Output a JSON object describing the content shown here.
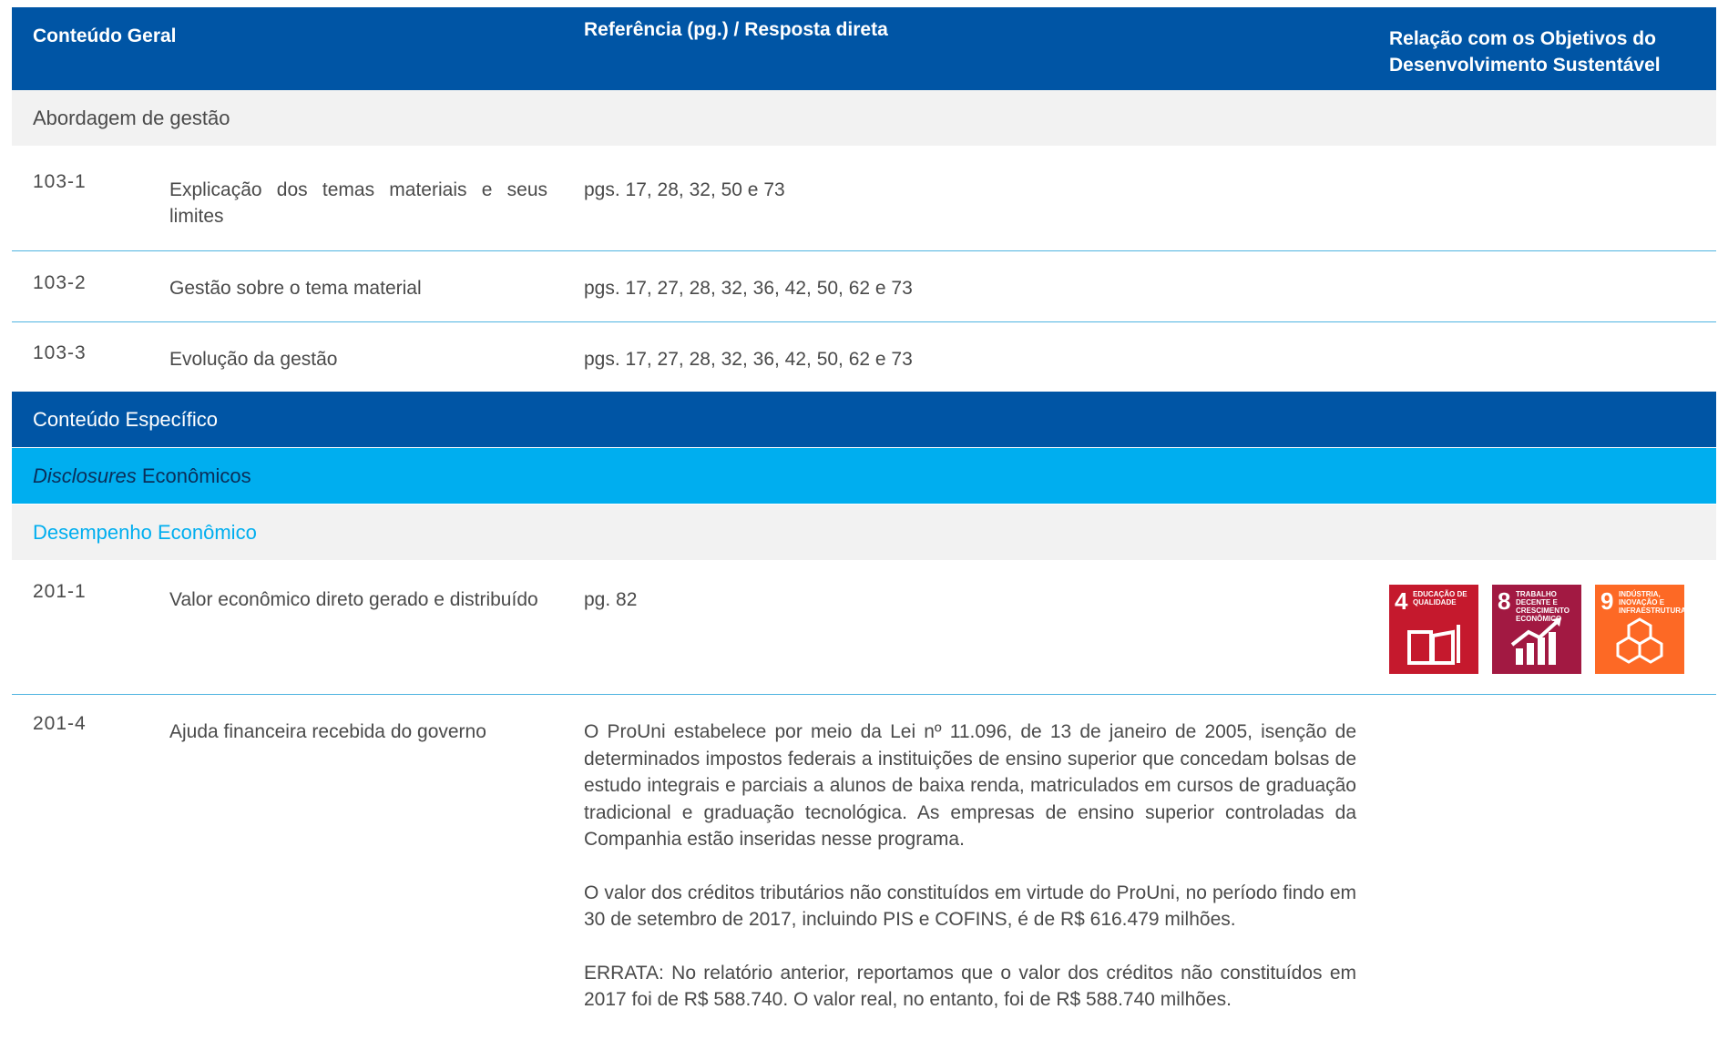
{
  "header": {
    "col1": "Conteúdo Geral",
    "col2": "Referência (pg.) / Resposta direta",
    "col3": "Relação  com os Objetivos do Desenvolvimento Sustentável"
  },
  "sections": {
    "management": "Abordagem de gestão",
    "specific": "Conteúdo Específico",
    "disclosures_italic": "Disclosures",
    "disclosures_rest": " Econômicos",
    "economic_performance": "Desempenho Econômico"
  },
  "rows": [
    {
      "code": "103-1",
      "desc": "Explicação dos temas materiais e seus limites",
      "ref": "pgs. 17, 28, 32, 50 e 73"
    },
    {
      "code": "103-2",
      "desc": "Gestão sobre o tema material",
      "ref": "pgs. 17, 27, 28, 32, 36, 42, 50, 62 e 73"
    },
    {
      "code": "103-3",
      "desc": "Evolução da gestão",
      "ref": "pgs. 17, 27, 28, 32, 36, 42, 50, 62 e 73"
    },
    {
      "code": "201-1",
      "desc": "Valor econômico direto gerado e distribuído",
      "ref": "pg. 82"
    },
    {
      "code": "201-4",
      "desc": "Ajuda financeira recebida do governo",
      "paragraphs": [
        "O ProUni estabelece por meio da Lei nº 11.096, de 13 de janeiro de 2005, isenção de determinados impostos federais a instituições de ensino superior que concedam bolsas de estudo integrais e parciais a alunos de baixa renda, matriculados em cursos de graduação tradicional e graduação tecnológica. As empresas de ensino superior controladas da Companhia estão inseridas nesse programa.",
        "O valor dos créditos tributários não constituídos em virtude do ProUni, no período findo em 30 de setembro de 2017, incluindo PIS e COFINS, é de R$ 616.479 milhões.",
        "ERRATA: No relatório anterior, reportamos que o valor dos créditos não constituídos em 2017 foi de R$ 588.740. O valor real, no entanto, foi de R$ 588.740 milhões."
      ]
    }
  ],
  "ods_icons": [
    {
      "number": "4",
      "label": "Educação de qualidade",
      "color": "#c5192d",
      "icon": "book-icon"
    },
    {
      "number": "8",
      "label": "Trabalho decente e crescimento econômico",
      "color": "#a21942",
      "icon": "growth-chart-icon"
    },
    {
      "number": "9",
      "label": "Indústria, inovação e infraestrutura",
      "color": "#fd6925",
      "icon": "cubes-icon"
    }
  ]
}
